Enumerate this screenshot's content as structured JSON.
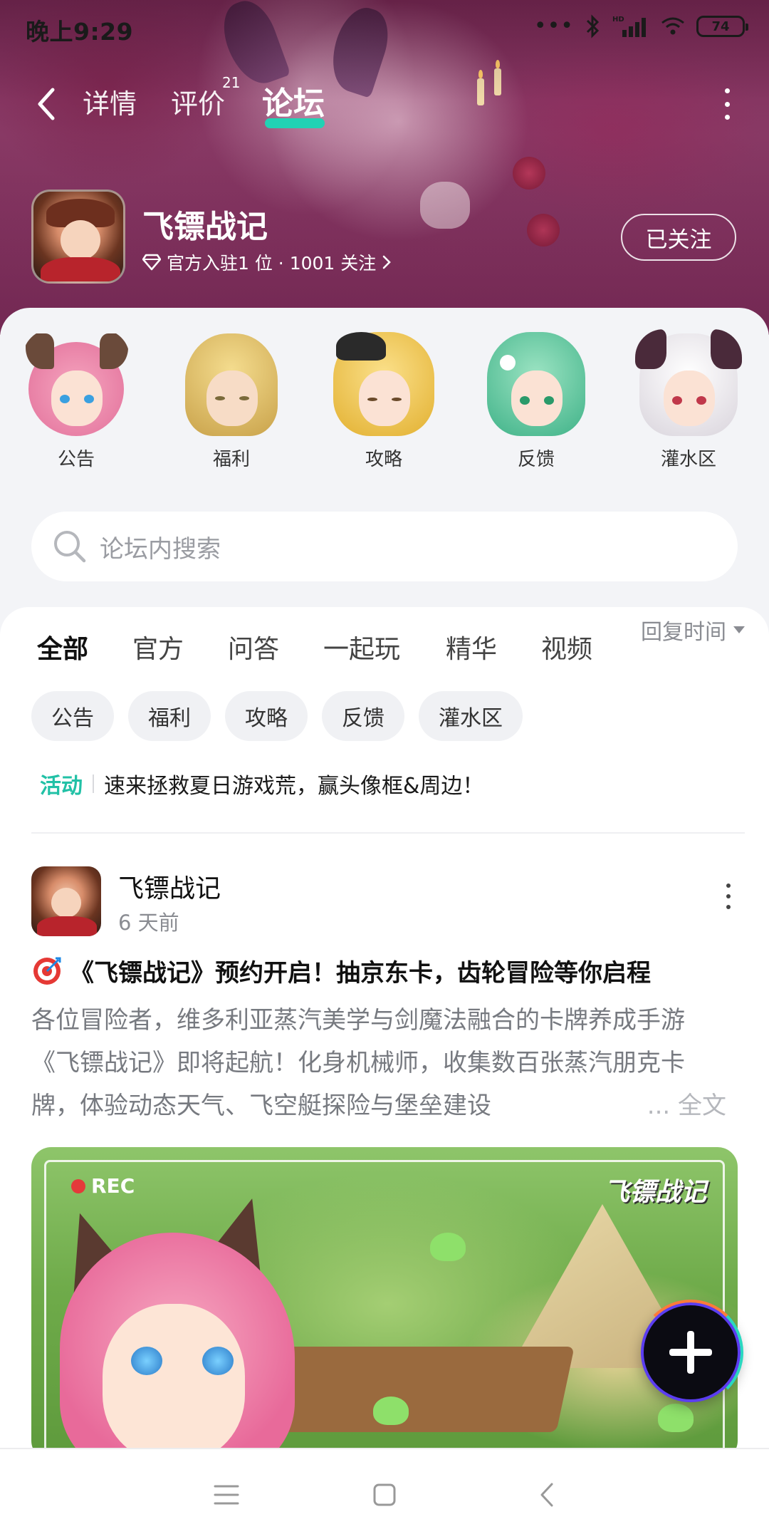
{
  "status_bar": {
    "time": "晚上9:29",
    "battery": "74",
    "network_label": "HD"
  },
  "top_nav": {
    "tabs": [
      {
        "label": "详情"
      },
      {
        "label": "评价",
        "badge": "21"
      },
      {
        "label": "论坛",
        "active": true
      }
    ]
  },
  "game": {
    "name": "飞镖战记",
    "subtitle": "官方入驻1 位 · 1001 关注",
    "follow_label": "已关注"
  },
  "boards": [
    {
      "label": "公告",
      "icon": "catgirl-avatar"
    },
    {
      "label": "福利",
      "icon": "blonde-man-avatar"
    },
    {
      "label": "攻略",
      "icon": "blonde-girl-avatar"
    },
    {
      "label": "反馈",
      "icon": "elf-girl-avatar"
    },
    {
      "label": "灌水区",
      "icon": "demon-girl-avatar"
    }
  ],
  "search": {
    "placeholder": "论坛内搜索"
  },
  "feed_tabs": [
    {
      "label": "全部",
      "active": true
    },
    {
      "label": "官方"
    },
    {
      "label": "问答"
    },
    {
      "label": "一起玩"
    },
    {
      "label": "精华"
    },
    {
      "label": "视频"
    }
  ],
  "sort_label": "回复时间",
  "chips": [
    "公告",
    "福利",
    "攻略",
    "反馈",
    "灌水区"
  ],
  "activity": {
    "tag": "活动",
    "text": "速来拯救夏日游戏荒，赢头像框&周边！"
  },
  "post": {
    "author": "飞镖战记",
    "time": "6 天前",
    "title": "《飞镖战记》预约开启！抽京东卡，齿轮冒险等你启程",
    "body": "各位冒险者，维多利亚蒸汽美学与剑魔法融合的卡牌养成手游《飞镖战记》即将起航！化身机械师，收集数百张蒸汽朋克卡牌，体验动态天气、飞空艇探险与堡垒建设",
    "full_label": "... 全文",
    "image": {
      "rec_label": "REC",
      "logo_text": "飞镖战记"
    }
  },
  "colors": {
    "accent": "#21d2b4",
    "banner": "#7a2a55",
    "activity_tag": "#21c1a6"
  }
}
